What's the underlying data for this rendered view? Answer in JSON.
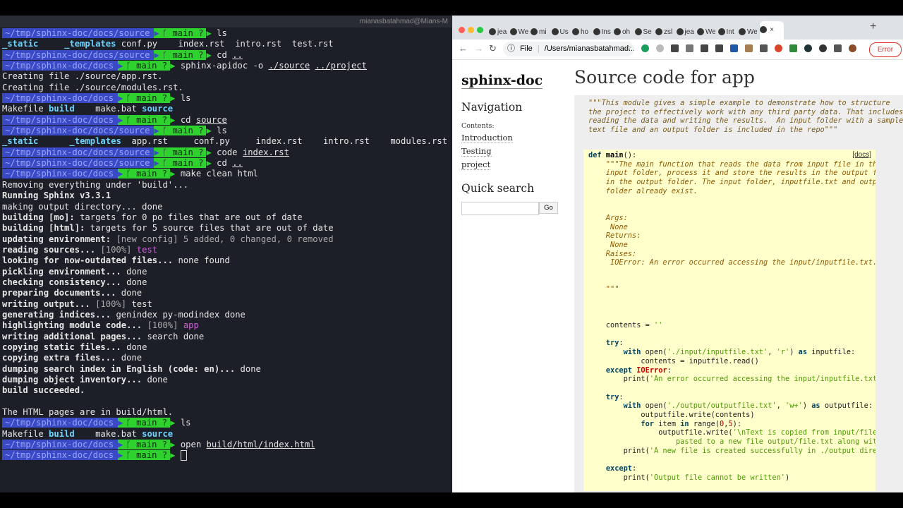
{
  "terminal": {
    "title": "mianasbatahmad@Mians-M",
    "prompts": {
      "dir_docs": "~/tmp/sphinx-doc/docs",
      "dir_source": "~/tmp/sphinx-doc/docs/source",
      "git": "main ?",
      "arrow": "❯"
    },
    "lines": [
      {
        "t": "p",
        "d": "~/tmp/sphinx-doc/docs/source",
        "c": [
          [
            "ls",
            "cmd"
          ]
        ]
      },
      {
        "t": "o",
        "c": [
          [
            "_static",
            "dir"
          ],
          [
            "     ",
            ""
          ],
          [
            "_templates",
            "dir"
          ],
          [
            " conf.py    index.rst  intro.rst  test.rst",
            ""
          ]
        ]
      },
      {
        "t": "p",
        "d": "~/tmp/sphinx-doc/docs/source",
        "c": [
          [
            "cd",
            "cmd"
          ],
          [
            " ",
            ""
          ],
          [
            "..",
            "ul"
          ]
        ]
      },
      {
        "t": "p",
        "d": "~/tmp/sphinx-doc/docs",
        "c": [
          [
            "sphinx-apidoc",
            "cmd"
          ],
          [
            " -o ",
            ""
          ],
          [
            "./source",
            "ul"
          ],
          [
            " ",
            ""
          ],
          [
            "../project",
            "ul"
          ]
        ]
      },
      {
        "t": "o",
        "c": [
          [
            "Creating file ./source/app.rst.",
            ""
          ]
        ]
      },
      {
        "t": "o",
        "c": [
          [
            "Creating file ./source/modules.rst.",
            ""
          ]
        ]
      },
      {
        "t": "p",
        "d": "~/tmp/sphinx-doc/docs",
        "c": [
          [
            "ls",
            "cmd"
          ]
        ]
      },
      {
        "t": "o",
        "c": [
          [
            "Makefile ",
            ""
          ],
          [
            "build",
            "dir"
          ],
          [
            "    make.bat ",
            ""
          ],
          [
            "source",
            "dir"
          ]
        ]
      },
      {
        "t": "p",
        "d": "~/tmp/sphinx-doc/docs",
        "c": [
          [
            "cd",
            "cmd"
          ],
          [
            " ",
            ""
          ],
          [
            "source",
            "ul"
          ]
        ]
      },
      {
        "t": "p",
        "d": "~/tmp/sphinx-doc/docs/source",
        "c": [
          [
            "ls",
            "cmd"
          ]
        ]
      },
      {
        "t": "o",
        "c": [
          [
            "_static",
            "dir"
          ],
          [
            "      ",
            ""
          ],
          [
            "_templates",
            "dir"
          ],
          [
            "  app.rst     conf.py     index.rst    intro.rst    modules.rst  test.rst",
            ""
          ]
        ]
      },
      {
        "t": "p",
        "d": "~/tmp/sphinx-doc/docs/source",
        "c": [
          [
            "code",
            "cmd"
          ],
          [
            " ",
            ""
          ],
          [
            "index.rst",
            "ul"
          ]
        ]
      },
      {
        "t": "p",
        "d": "~/tmp/sphinx-doc/docs/source",
        "c": [
          [
            "cd",
            "cmd"
          ],
          [
            " ",
            ""
          ],
          [
            "..",
            "ul"
          ]
        ]
      },
      {
        "t": "p",
        "d": "~/tmp/sphinx-doc/docs",
        "c": [
          [
            "make",
            "cmd"
          ],
          [
            " clean html",
            ""
          ]
        ]
      },
      {
        "t": "o",
        "c": [
          [
            "Removing everything under 'build'...",
            ""
          ]
        ]
      },
      {
        "t": "o",
        "c": [
          [
            "Running Sphinx v3.3.1",
            "bold"
          ]
        ]
      },
      {
        "t": "o",
        "c": [
          [
            "making output directory... done",
            ""
          ]
        ]
      },
      {
        "t": "o",
        "c": [
          [
            "building [mo]: ",
            "bold"
          ],
          [
            "targets for 0 po files that are out of date",
            ""
          ]
        ]
      },
      {
        "t": "o",
        "c": [
          [
            "building [html]: ",
            "bold"
          ],
          [
            "targets for 5 source files that are out of date",
            ""
          ]
        ]
      },
      {
        "t": "o",
        "c": [
          [
            "updating environment: ",
            "bold"
          ],
          [
            "[new config] 5 added, 0 changed, 0 removed",
            "dim"
          ]
        ]
      },
      {
        "t": "o",
        "c": [
          [
            "reading sources... ",
            "bold"
          ],
          [
            "[100%] ",
            "dim"
          ],
          [
            "test",
            "pink"
          ]
        ]
      },
      {
        "t": "o",
        "c": [
          [
            "looking for now-outdated files... ",
            "bold"
          ],
          [
            "none found",
            ""
          ]
        ]
      },
      {
        "t": "o",
        "c": [
          [
            "pickling environment... ",
            "bold"
          ],
          [
            "done",
            ""
          ]
        ]
      },
      {
        "t": "o",
        "c": [
          [
            "checking consistency... ",
            "bold"
          ],
          [
            "done",
            ""
          ]
        ]
      },
      {
        "t": "o",
        "c": [
          [
            "preparing documents... ",
            "bold"
          ],
          [
            "done",
            ""
          ]
        ]
      },
      {
        "t": "o",
        "c": [
          [
            "writing output... ",
            "bold"
          ],
          [
            "[100%] ",
            "dim"
          ],
          [
            "test",
            "cmd"
          ]
        ]
      },
      {
        "t": "o",
        "c": [
          [
            "generating indices... ",
            "bold"
          ],
          [
            "genindex py-modindex done",
            ""
          ]
        ]
      },
      {
        "t": "o",
        "c": [
          [
            "highlighting module code... ",
            "bold"
          ],
          [
            "[100%] ",
            "dim"
          ],
          [
            "app",
            "pink"
          ]
        ]
      },
      {
        "t": "o",
        "c": [
          [
            "writing additional pages... ",
            "bold"
          ],
          [
            "search done",
            ""
          ]
        ]
      },
      {
        "t": "o",
        "c": [
          [
            "copying static files... ",
            "bold"
          ],
          [
            "done",
            ""
          ]
        ]
      },
      {
        "t": "o",
        "c": [
          [
            "copying extra files... ",
            "bold"
          ],
          [
            "done",
            ""
          ]
        ]
      },
      {
        "t": "o",
        "c": [
          [
            "dumping search index in English (code: en)... ",
            "bold"
          ],
          [
            "done",
            ""
          ]
        ]
      },
      {
        "t": "o",
        "c": [
          [
            "dumping object inventory... ",
            "bold"
          ],
          [
            "done",
            ""
          ]
        ]
      },
      {
        "t": "o",
        "c": [
          [
            "build succeeded.",
            "bold"
          ]
        ]
      },
      {
        "t": "o",
        "c": [
          [
            "",
            ""
          ]
        ]
      },
      {
        "t": "o",
        "c": [
          [
            "The HTML pages are in build/html.",
            ""
          ]
        ]
      },
      {
        "t": "p",
        "d": "~/tmp/sphinx-doc/docs",
        "c": [
          [
            "ls",
            "cmd"
          ]
        ]
      },
      {
        "t": "o",
        "c": [
          [
            "Makefile ",
            ""
          ],
          [
            "build",
            "dir"
          ],
          [
            "    make.bat ",
            ""
          ],
          [
            "source",
            "dir"
          ]
        ]
      },
      {
        "t": "p",
        "d": "~/tmp/sphinx-doc/docs",
        "c": [
          [
            "open",
            "cmd"
          ],
          [
            " ",
            ""
          ],
          [
            "build/html/index.html",
            "ul"
          ]
        ]
      },
      {
        "t": "p",
        "d": "~/tmp/sphinx-doc/docs",
        "c": [],
        "cursor": true
      }
    ]
  },
  "browser": {
    "tabs": [
      "jea",
      "We",
      "mi",
      "Us",
      "ho",
      "Ins",
      "oh",
      "Se",
      "zsl",
      "jea",
      "We",
      "Int",
      "We"
    ],
    "address_file_label": "File",
    "address_url": "/Users/mianasbatahmad...",
    "error_label": "Error",
    "colors": {
      "code_bg": "#ffffcc",
      "terminal_bg": "#1d1f28",
      "prompt_dir_bg": "#3a49c6",
      "prompt_git_bg": "#2fd12f"
    }
  },
  "sidebar": {
    "site_title": "sphinx-doc",
    "nav_heading": "Navigation",
    "contents_label": "Contents:",
    "links": [
      "Introduction",
      "Testing",
      "project"
    ],
    "quick_search_heading": "Quick search",
    "go_button": "Go"
  },
  "content": {
    "title": "Source code for app",
    "docs_link": "[docs]",
    "module_doc": "\"\"\"This module gives a simple example to demonstrate how to structure\nthe project to effectively work with any third party data. That includes\nreading the data and writing the results.  An input folder with a sample\ntext file and an output folder is included in the repo\"\"\"",
    "code": [
      [
        [
          "def ",
          "kw"
        ],
        [
          "main",
          "fn"
        ],
        [
          "():",
          ""
        ]
      ],
      [
        [
          "    \"\"\"The main function that reads the data from input file in the",
          "doc"
        ]
      ],
      [
        [
          "    input folder, process it and store the results in the output file",
          "doc"
        ]
      ],
      [
        [
          "    in the output folder. The input folder, inputfile.txt and output",
          "doc"
        ]
      ],
      [
        [
          "    folder already exist.",
          "doc"
        ]
      ],
      [
        [
          "",
          ""
        ]
      ],
      [
        [
          "",
          ""
        ]
      ],
      [
        [
          "    Args:",
          "doc"
        ]
      ],
      [
        [
          "     None",
          "doc"
        ]
      ],
      [
        [
          "    Returns:",
          "doc"
        ]
      ],
      [
        [
          "     None",
          "doc"
        ]
      ],
      [
        [
          "    Raises:",
          "doc"
        ]
      ],
      [
        [
          "     IOError: An error occurred accessing the input/inputfile.txt.",
          "doc"
        ]
      ],
      [
        [
          "",
          ""
        ]
      ],
      [
        [
          "",
          ""
        ]
      ],
      [
        [
          "    \"\"\"",
          "doc"
        ]
      ],
      [
        [
          "",
          ""
        ]
      ],
      [
        [
          "",
          ""
        ]
      ],
      [
        [
          "",
          ""
        ]
      ],
      [
        [
          "    contents = ",
          ""
        ],
        [
          "''",
          "str"
        ]
      ],
      [
        [
          "",
          ""
        ]
      ],
      [
        [
          "    ",
          ""
        ],
        [
          "try",
          "kw"
        ],
        [
          ":",
          ""
        ]
      ],
      [
        [
          "        ",
          ""
        ],
        [
          "with ",
          "kw"
        ],
        [
          "open(",
          ""
        ],
        [
          "'./input/inputfile.txt'",
          "str"
        ],
        [
          ", ",
          ""
        ],
        [
          "'r'",
          "str"
        ],
        [
          ") ",
          ""
        ],
        [
          "as ",
          "kw"
        ],
        [
          "inputfile:",
          ""
        ]
      ],
      [
        [
          "            contents = inputfile.read()",
          ""
        ]
      ],
      [
        [
          "    ",
          ""
        ],
        [
          "except ",
          "kw"
        ],
        [
          "IOError",
          "exc"
        ],
        [
          ":",
          ""
        ]
      ],
      [
        [
          "        print(",
          ""
        ],
        [
          "'An error occurred accessing the input/inputfile.txt'",
          "str"
        ],
        [
          ")",
          ""
        ]
      ],
      [
        [
          "",
          ""
        ]
      ],
      [
        [
          "    ",
          ""
        ],
        [
          "try",
          "kw"
        ],
        [
          ":",
          ""
        ]
      ],
      [
        [
          "        ",
          ""
        ],
        [
          "with ",
          "kw"
        ],
        [
          "open(",
          ""
        ],
        [
          "'./output/outputfile.txt'",
          "str"
        ],
        [
          ", ",
          ""
        ],
        [
          "'w+'",
          "str"
        ],
        [
          ") ",
          ""
        ],
        [
          "as ",
          "kw"
        ],
        [
          "outputfile:",
          ""
        ]
      ],
      [
        [
          "            outputfile.write(contents)",
          ""
        ]
      ],
      [
        [
          "            ",
          ""
        ],
        [
          "for ",
          "kw"
        ],
        [
          "item ",
          ""
        ],
        [
          "in ",
          "kw"
        ],
        [
          "range(",
          ""
        ],
        [
          "0",
          "num"
        ],
        [
          ",",
          ""
        ],
        [
          "5",
          "num"
        ],
        [
          "):",
          ""
        ]
      ],
      [
        [
          "                outputfile.write(",
          ""
        ],
        [
          "'\\nText is copied from input/file.txt and",
          "str"
        ]
      ],
      [
        [
          "                    pasted to a new file output/file.txt along with these",
          "str"
        ]
      ],
      [
        [
          "        print(",
          ""
        ],
        [
          "'A new file is created successfully in ./output directory",
          "str"
        ]
      ],
      [
        [
          "",
          ""
        ]
      ],
      [
        [
          "    ",
          ""
        ],
        [
          "except",
          "kw"
        ],
        [
          ":",
          ""
        ]
      ],
      [
        [
          "        print(",
          ""
        ],
        [
          "'Output file cannot be written'",
          "str"
        ],
        [
          ")",
          ""
        ]
      ]
    ]
  }
}
